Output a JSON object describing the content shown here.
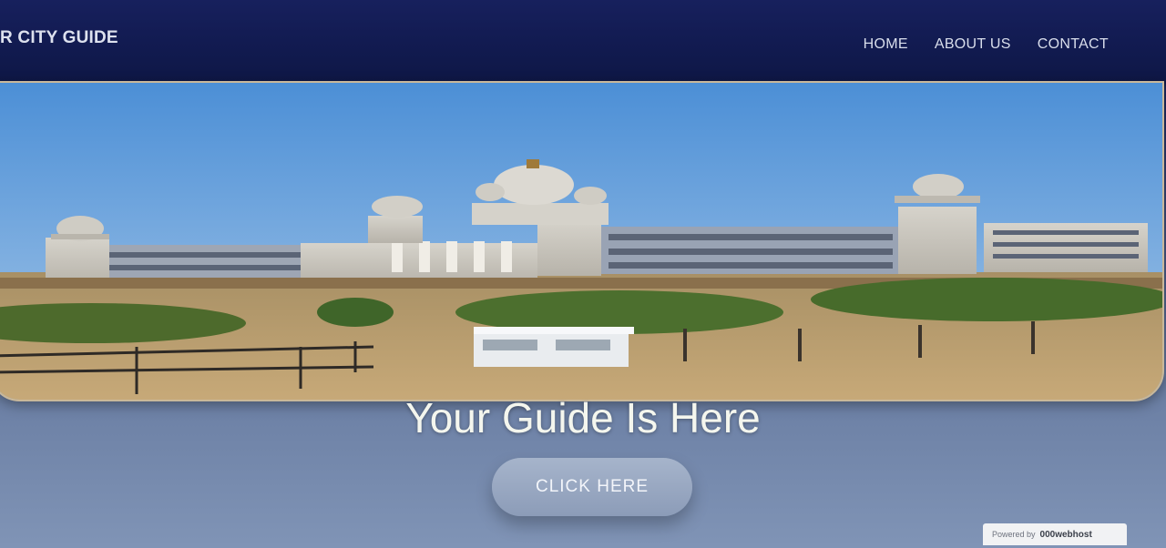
{
  "navbar": {
    "brand": "R CITY GUIDE",
    "links": [
      {
        "label": "HOME"
      },
      {
        "label": "ABOUT US"
      },
      {
        "label": "CONTACT"
      }
    ]
  },
  "hero": {
    "image_subject": "panoramic-government-building-photo",
    "title": "Your Guide Is Here",
    "cta_label": "CLICK HERE"
  },
  "footer_badge": {
    "powered_by": "Powered by",
    "host": "000webhost"
  },
  "colors": {
    "navbar": "#141d55",
    "sky": "#5f9cd8",
    "button": "#97a6c2",
    "title_text": "#f4f6ee"
  }
}
